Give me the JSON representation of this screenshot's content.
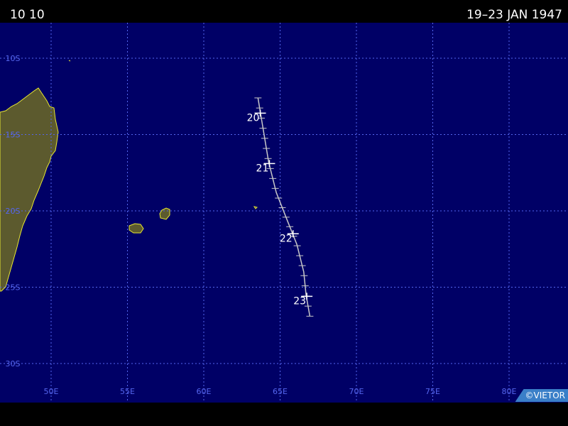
{
  "header": {
    "storm_id": "10 10",
    "dates": "19–23 JAN 1947"
  },
  "credit": "©VIETOR",
  "map": {
    "ocean_color": "#000066",
    "land_color": "#5c5a2e",
    "coast_color": "#e8e830",
    "grid_color": "#5566ee",
    "track_color": "#c8c8c8",
    "lon_labels": [
      "50E",
      "55E",
      "60E",
      "65E",
      "70E",
      "75E",
      "80E"
    ],
    "lat_labels": [
      "10S",
      "15S",
      "20S",
      "25S",
      "30S"
    ],
    "track": [
      {
        "lon": 63.55,
        "lat": -12.6
      },
      {
        "lon": 63.7,
        "lat": -13.5
      },
      {
        "lon": 63.95,
        "lat": -15.0
      },
      {
        "lon": 64.25,
        "lat": -16.8
      },
      {
        "lon": 64.75,
        "lat": -18.8
      },
      {
        "lon": 65.5,
        "lat": -20.7
      },
      {
        "lon": 66.1,
        "lat": -22.2
      },
      {
        "lon": 66.55,
        "lat": -24.0
      },
      {
        "lon": 66.7,
        "lat": -25.5
      },
      {
        "lon": 66.95,
        "lat": -26.9
      }
    ],
    "day_labels": [
      {
        "day": "20",
        "lon": 63.7,
        "lat": -13.6
      },
      {
        "day": "21",
        "lon": 64.3,
        "lat": -16.9
      },
      {
        "day": "22",
        "lon": 65.85,
        "lat": -21.5
      },
      {
        "day": "23",
        "lon": 66.75,
        "lat": -25.6
      }
    ]
  }
}
